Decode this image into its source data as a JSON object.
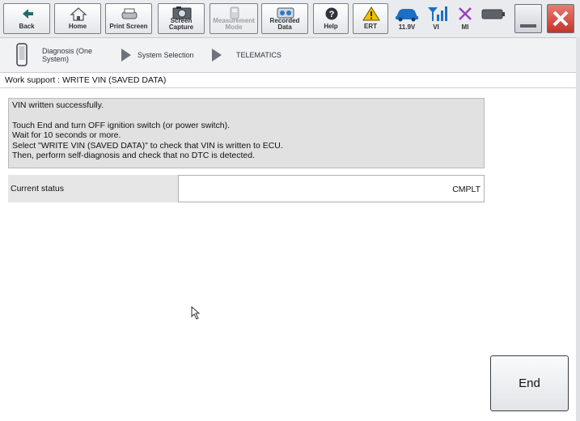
{
  "toolbar": {
    "buttons": [
      {
        "label": "Back",
        "icon": "back-arrow-icon"
      },
      {
        "label": "Home",
        "icon": "home-icon"
      },
      {
        "label": "Print Screen",
        "icon": "printer-icon"
      },
      {
        "label_line1": "Screen",
        "label_line2": "Capture",
        "icon": "camera-icon"
      },
      {
        "label_line1": "Measurement",
        "label_line2": "Mode",
        "icon": "measurement-icon"
      },
      {
        "label_line1": "Recorded",
        "label_line2": "Data",
        "icon": "recorded-data-icon"
      },
      {
        "label": "Help",
        "icon": "help-icon"
      },
      {
        "label": "ERT",
        "icon": "warning-icon"
      }
    ],
    "status": {
      "voltage": "11.9V",
      "vi": "VI",
      "mi": "MI"
    }
  },
  "breadcrumb": {
    "item1_line1": "Diagnosis (One",
    "item1_line2": "System)",
    "item2": "System Selection",
    "item3": "TELEMATICS"
  },
  "page": {
    "title": "Work support : WRITE VIN (SAVED DATA)"
  },
  "message": {
    "line1": "VIN written successfully.",
    "line2": "Touch End and turn OFF ignition switch (or power switch).",
    "line3": "Wait for 10 seconds or more.",
    "line4": "Select \"WRITE VIN (SAVED DATA)\" to check that VIN is written to ECU.",
    "line5": "Then, perform self-diagnosis and check that no DTC is detected."
  },
  "status": {
    "label": "Current status",
    "value": "CMPLT"
  },
  "end_button": {
    "label": "End"
  },
  "colors": {
    "toolbar_bg": "#e9ebee",
    "message_bg": "#e1e1e1",
    "close_red": "#c2352a",
    "battery_blue": "#1b6fc4",
    "mi_purple": "#9b3fbf",
    "warning_yellow": "#f2c200"
  }
}
